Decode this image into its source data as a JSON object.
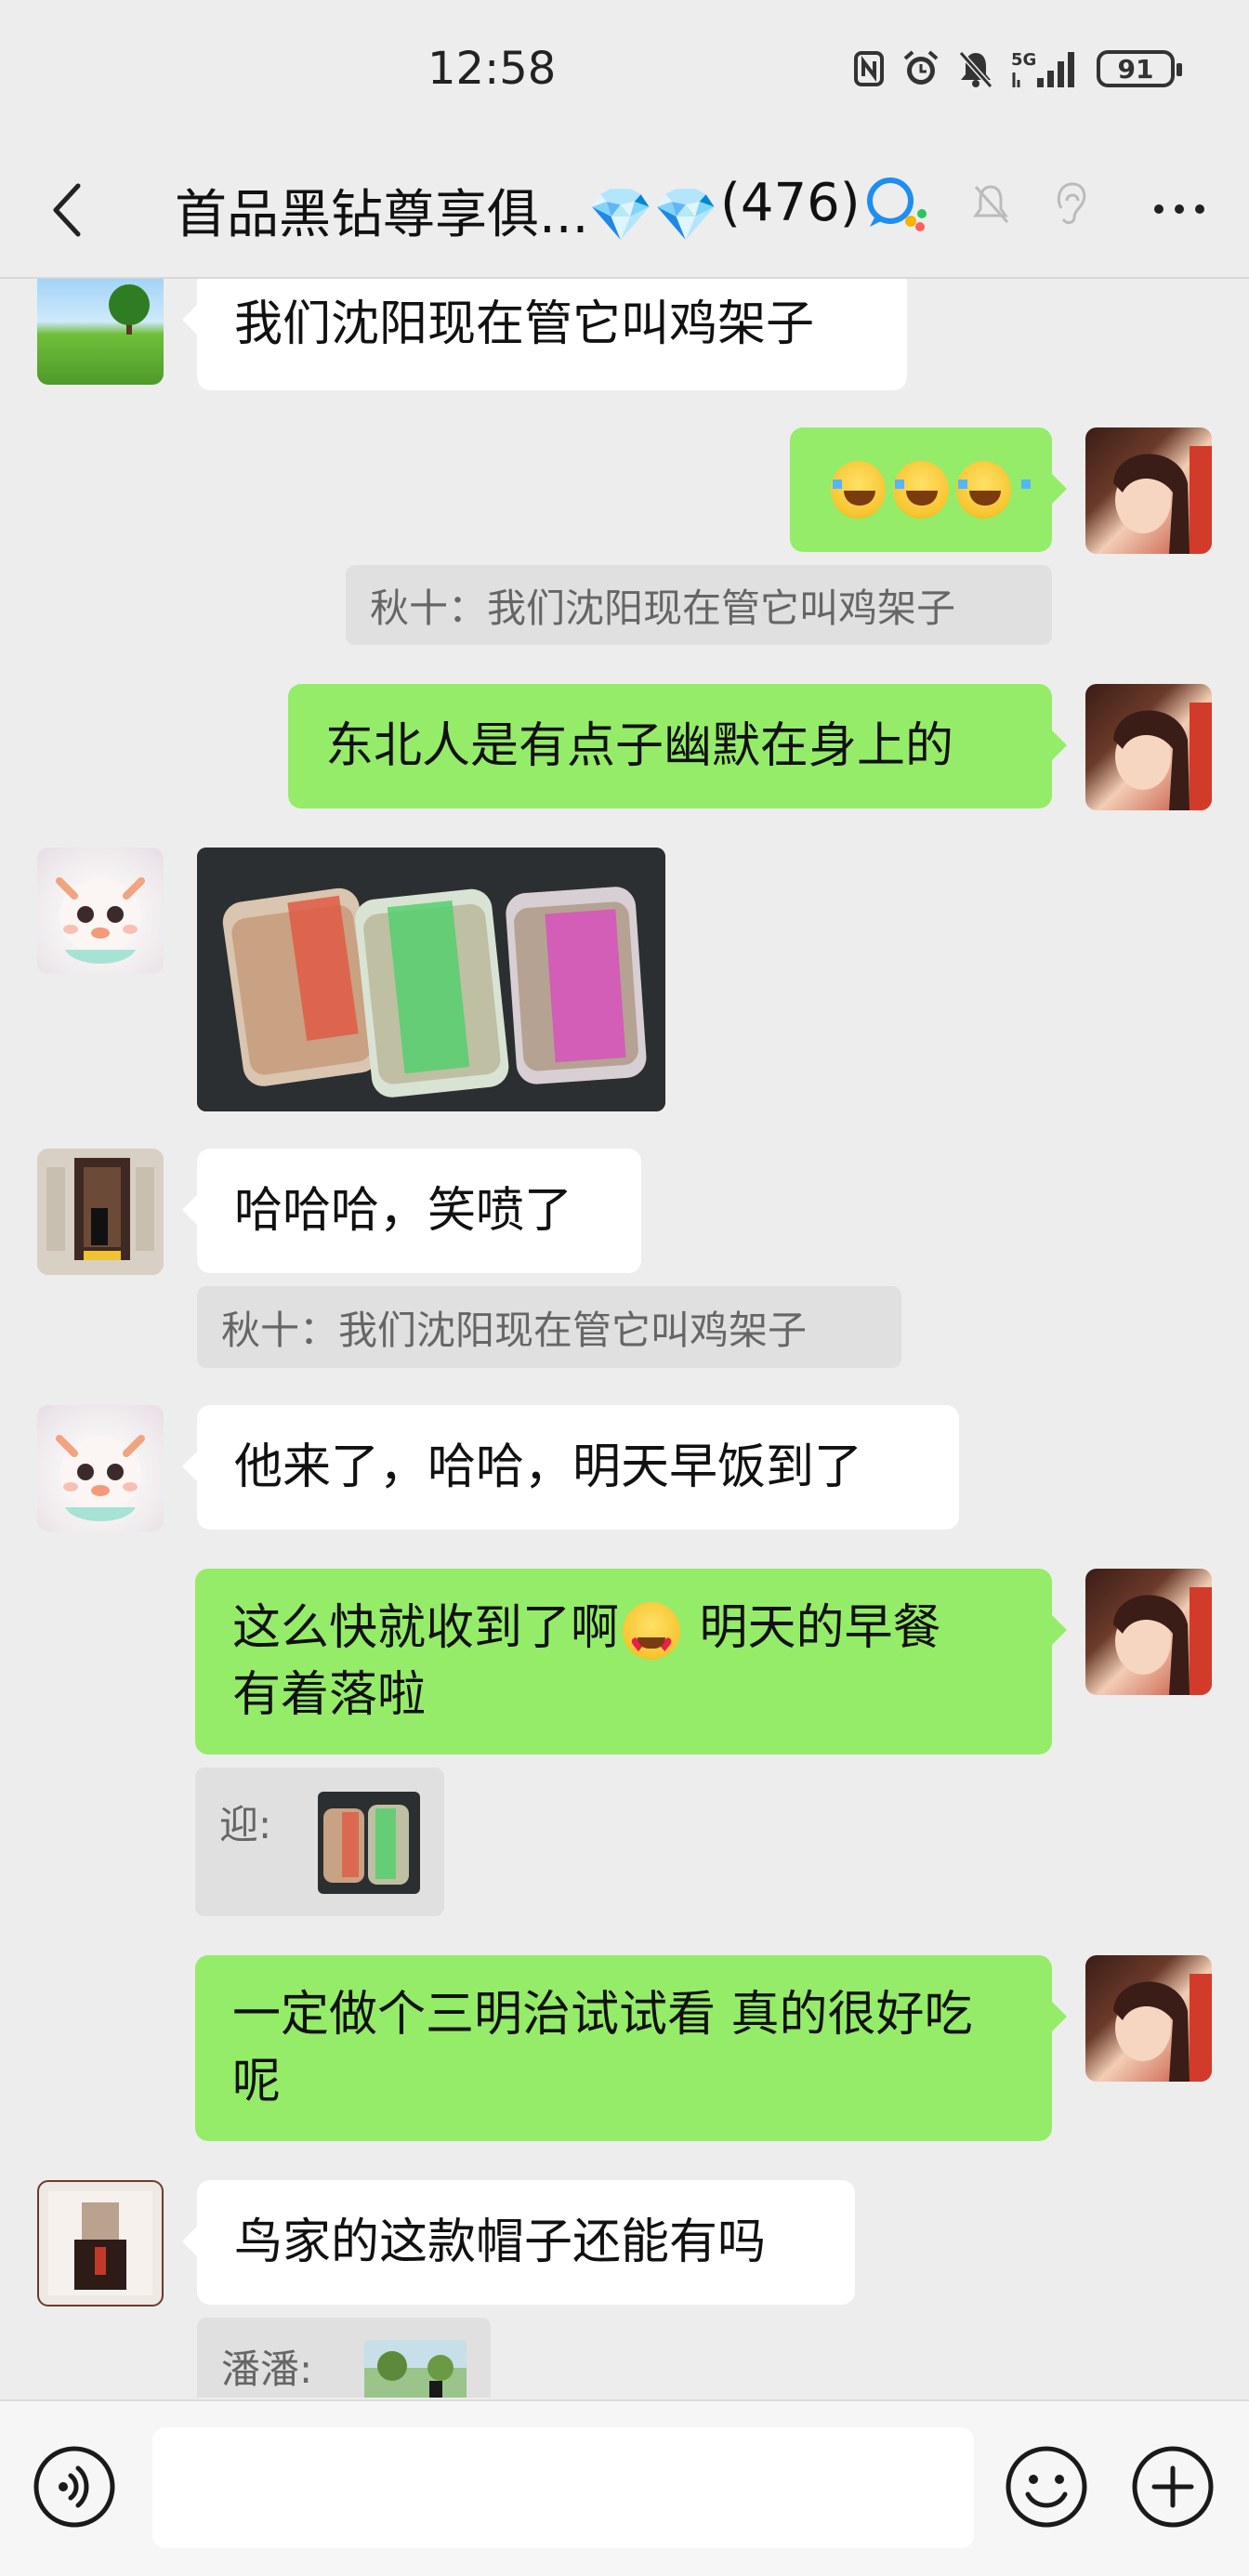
{
  "status_bar": {
    "time": "12:58",
    "battery": "91",
    "network": "5G",
    "icons": [
      "nfc-icon",
      "alarm-icon",
      "mute-icon",
      "signal-icon",
      "battery-icon"
    ]
  },
  "header": {
    "title": "首品黑钻尊享俱...💎💎",
    "member_count": "(476)",
    "icons": [
      "back-icon",
      "group-chat-icon",
      "mute-bell-icon",
      "ear-icon",
      "more-icon"
    ]
  },
  "messages": [
    {
      "side": "left",
      "text": "我们沈阳现在管它叫鸡架子"
    },
    {
      "side": "right",
      "emoji": [
        "laugh-tears-emoji",
        "laugh-tears-emoji",
        "laugh-tears-emoji"
      ],
      "quote": "秋十：我们沈阳现在管它叫鸡架子"
    },
    {
      "side": "right",
      "text": "东北人是有点子幽默在身上的"
    },
    {
      "side": "left",
      "type": "image",
      "image_desc": "three-wrapped-bread-photo"
    },
    {
      "side": "left",
      "text": "哈哈哈，笑喷了",
      "quote": "秋十：我们沈阳现在管它叫鸡架子"
    },
    {
      "side": "left",
      "text": "他来了，哈哈，明天早饭到了"
    },
    {
      "side": "right",
      "text_line1_a": "这么快就收到了啊",
      "text_line1_b": " 明天的早餐",
      "text_line2": "有着落啦",
      "quote_label": "迎:"
    },
    {
      "side": "right",
      "text_line1": "一定做个三明治试试看 真的很好吃",
      "text_line2": "呢"
    },
    {
      "side": "left",
      "text": "鸟家的这款帽子还能有吗",
      "quote_label": "潘潘:"
    }
  ],
  "input": {
    "value": "",
    "placeholder": ""
  },
  "colors": {
    "background": "#ededed",
    "sent_bubble": "#95ec69",
    "received_bubble": "#ffffff",
    "quote_bg": "#e0e0e0"
  }
}
